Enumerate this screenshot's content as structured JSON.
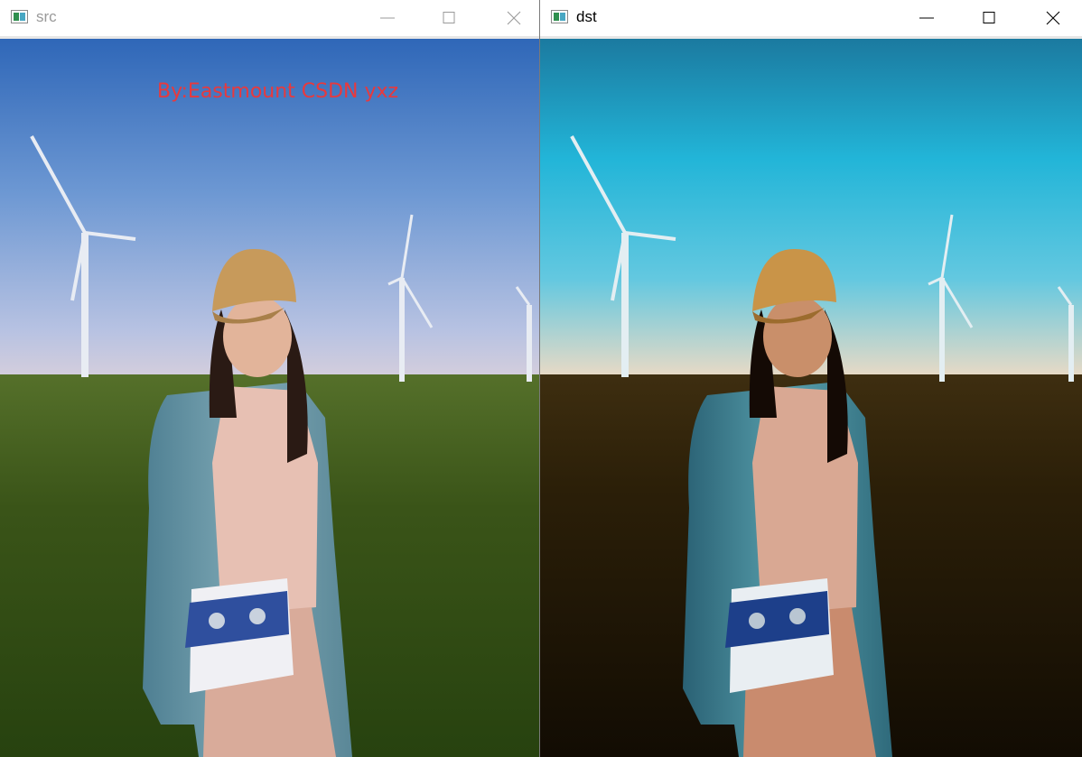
{
  "windows": {
    "src": {
      "title": "src",
      "watermark": "By:Eastmount CSDN yxz"
    },
    "dst": {
      "title": "dst"
    }
  },
  "icons": [
    "app-icon",
    "minimize-icon",
    "maximize-icon",
    "close-icon"
  ],
  "colors": {
    "watermark": "#e8393d",
    "inactive_title": "#9a9a9a",
    "active_title": "#000000"
  }
}
